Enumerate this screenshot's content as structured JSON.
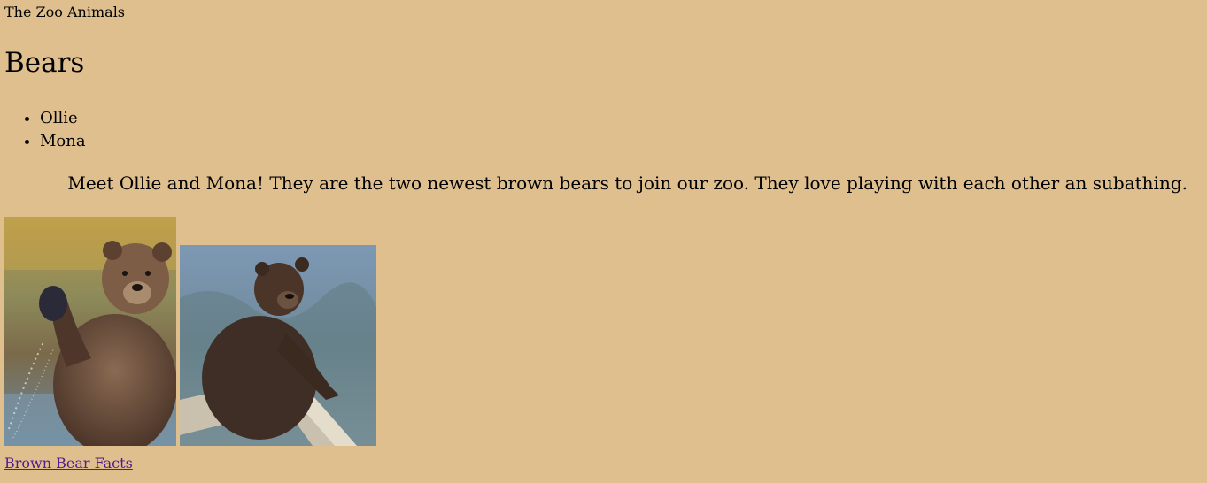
{
  "site": {
    "title": "The Zoo Animals"
  },
  "page": {
    "heading": "Bears",
    "bears": [
      "Ollie",
      "Mona"
    ],
    "intro": "Meet Ollie and Mona! They are the two newest brown bears to join our zoo. They love playing with each other an subathing."
  },
  "images": [
    {
      "name": "bear-waving-photo"
    },
    {
      "name": "bear-on-log-photo"
    }
  ],
  "link": {
    "label": "Brown Bear Facts"
  },
  "colors": {
    "background": "#dfbf8e",
    "link": "#551a8b"
  }
}
